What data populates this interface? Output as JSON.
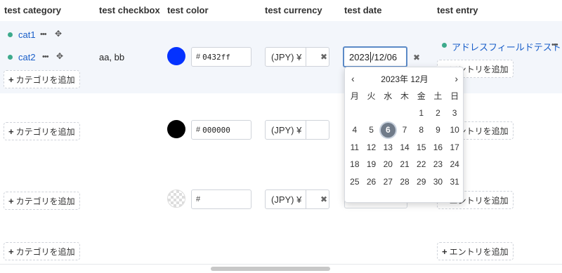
{
  "headers": {
    "category": "test category",
    "checkbox": "test checkbox",
    "color": "test color",
    "currency": "test currency",
    "date": "test date",
    "entry": "test entry"
  },
  "row1": {
    "categories": [
      "cat1",
      "cat2"
    ],
    "checkbox_value": "aa, bb",
    "color_value": "0432ff",
    "color_hex": "#0432ff",
    "currency_symbol": "(JPY) ¥",
    "date_value_before_caret": "2023",
    "date_value_after_caret": "/12/06",
    "entry_link": "アドレスフィールドテスト"
  },
  "row2": {
    "color_value": "000000",
    "color_hex": "#000000",
    "currency_symbol": "(JPY) ¥"
  },
  "row3": {
    "color_value": "",
    "currency_symbol": "(JPY) ¥"
  },
  "labels": {
    "hash": "#",
    "add_category": "カテゴリを追加",
    "add_entry": "エントリを追加",
    "plus": "+",
    "ellipsis": "•••",
    "move": "✥",
    "clear": "✖"
  },
  "calendar": {
    "month_label": "2023年 12月",
    "prev": "‹",
    "next": "›",
    "weekdays": [
      "月",
      "火",
      "水",
      "木",
      "金",
      "土",
      "日"
    ],
    "selected_day": "6",
    "weeks": [
      [
        "",
        "",
        "",
        "",
        "1",
        "2",
        "3"
      ],
      [
        "4",
        "5",
        "6",
        "7",
        "8",
        "9",
        "10"
      ],
      [
        "11",
        "12",
        "13",
        "14",
        "15",
        "16",
        "17"
      ],
      [
        "18",
        "19",
        "20",
        "21",
        "22",
        "23",
        "24"
      ],
      [
        "25",
        "26",
        "27",
        "28",
        "29",
        "30",
        "31"
      ]
    ]
  },
  "colors": {
    "accent_link": "#1a5fc9",
    "dot": "#3daa8c",
    "row_highlight": "#f3f6fb",
    "focus_border": "#5b8ac7",
    "selected_day_bg": "#707b89"
  }
}
